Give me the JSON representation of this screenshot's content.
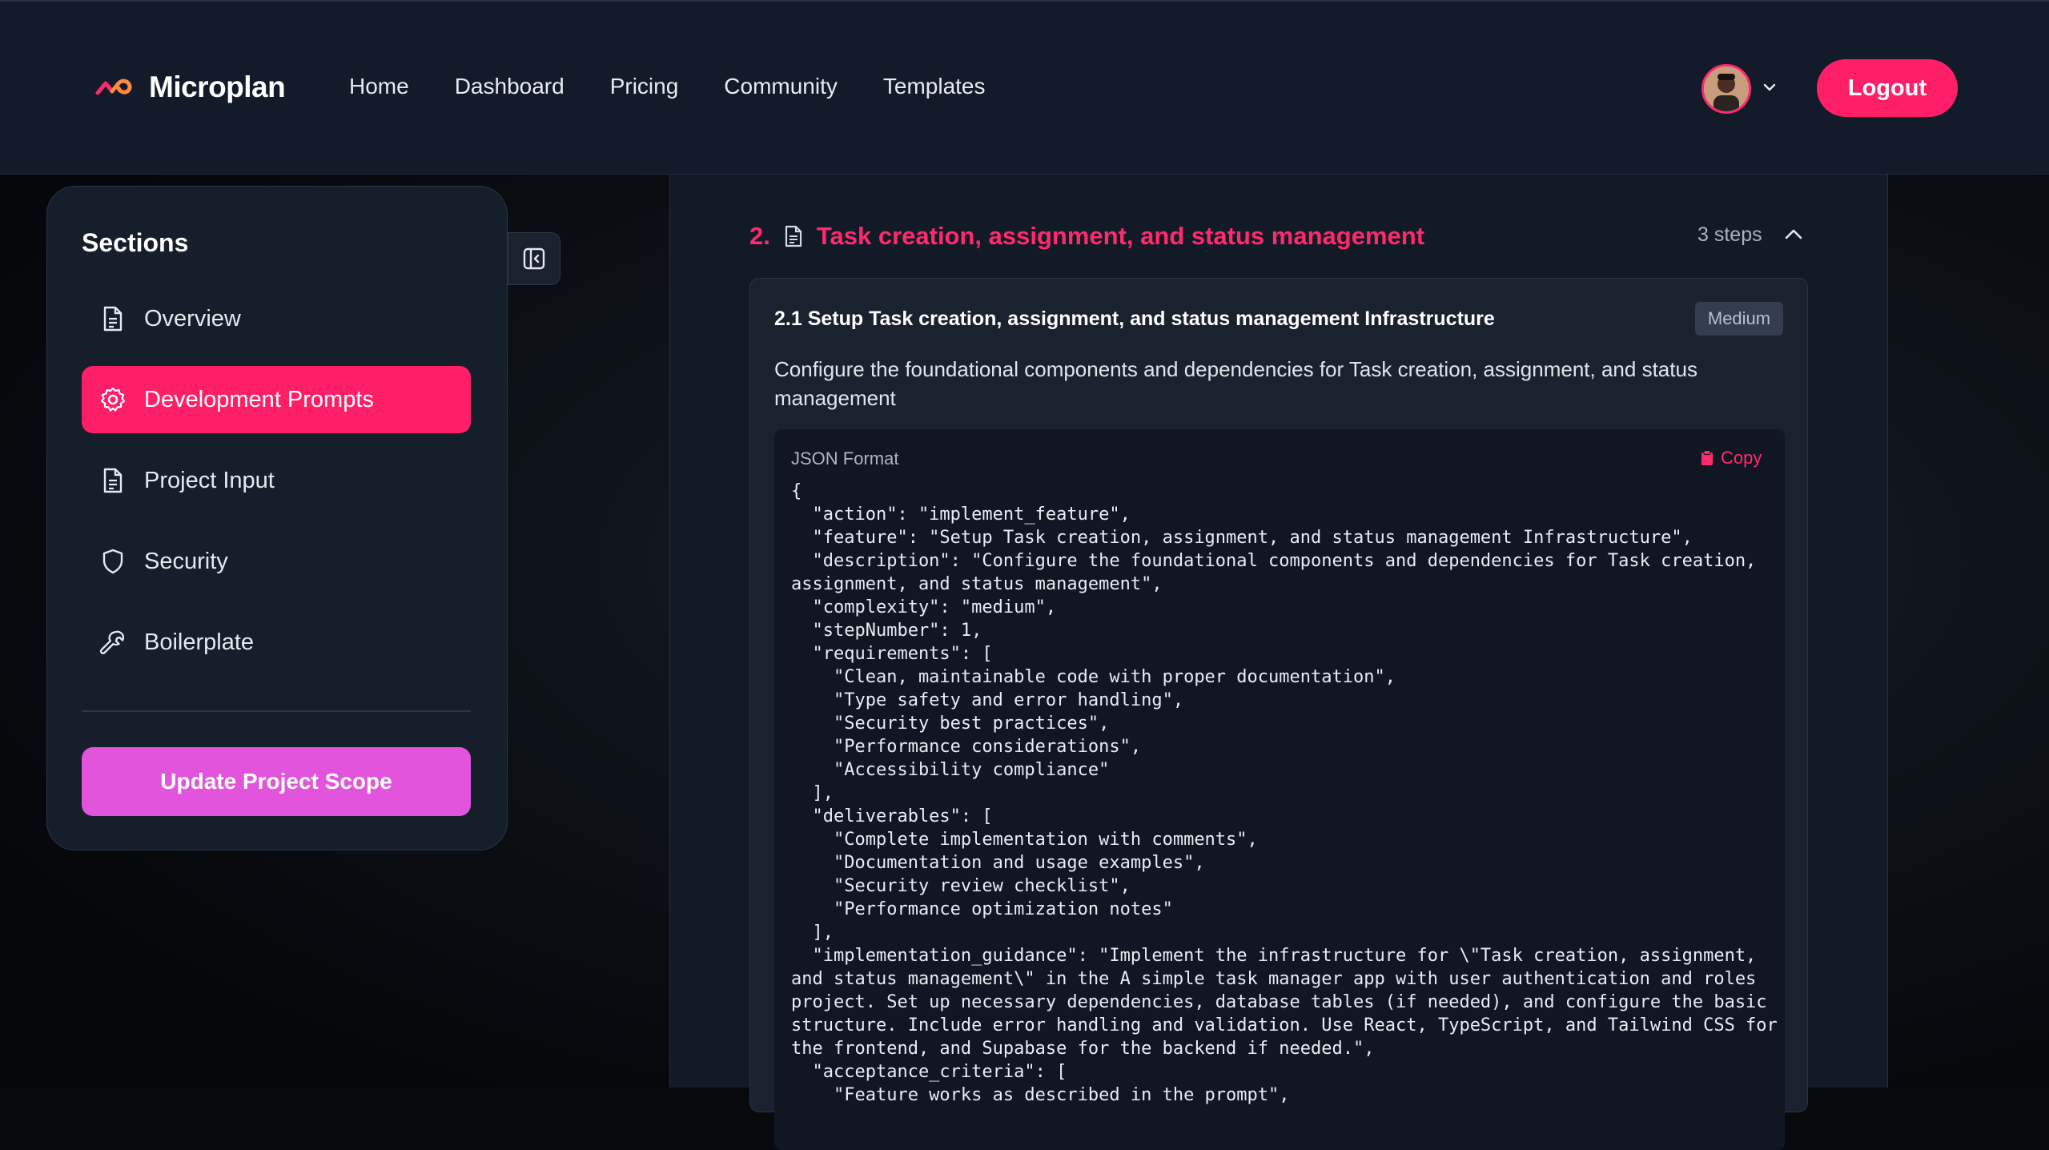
{
  "header": {
    "brand": "Microplan",
    "nav": [
      "Home",
      "Dashboard",
      "Pricing",
      "Community",
      "Templates"
    ],
    "logout_label": "Logout"
  },
  "sidebar": {
    "title": "Sections",
    "items": [
      {
        "label": "Overview",
        "icon": "document-icon",
        "active": false
      },
      {
        "label": "Development Prompts",
        "icon": "gear-icon",
        "active": true
      },
      {
        "label": "Project Input",
        "icon": "document-icon",
        "active": false
      },
      {
        "label": "Security",
        "icon": "shield-icon",
        "active": false
      },
      {
        "label": "Boilerplate",
        "icon": "wrench-icon",
        "active": false
      }
    ],
    "update_label": "Update Project Scope"
  },
  "section": {
    "number": "2.",
    "title": "Task creation, assignment, and status management",
    "steps": "3 steps"
  },
  "step": {
    "title": "2.1 Setup Task creation, assignment, and status management Infrastructure",
    "badge": "Medium",
    "description": "Configure the foundational components and dependencies for Task creation, assignment, and status management",
    "code_label": "JSON Format",
    "copy_label": "Copy",
    "code": "{\n  \"action\": \"implement_feature\",\n  \"feature\": \"Setup Task creation, assignment, and status management Infrastructure\",\n  \"description\": \"Configure the foundational components and dependencies for Task creation,\nassignment, and status management\",\n  \"complexity\": \"medium\",\n  \"stepNumber\": 1,\n  \"requirements\": [\n    \"Clean, maintainable code with proper documentation\",\n    \"Type safety and error handling\",\n    \"Security best practices\",\n    \"Performance considerations\",\n    \"Accessibility compliance\"\n  ],\n  \"deliverables\": [\n    \"Complete implementation with comments\",\n    \"Documentation and usage examples\",\n    \"Security review checklist\",\n    \"Performance optimization notes\"\n  ],\n  \"implementation_guidance\": \"Implement the infrastructure for \\\"Task creation, assignment,\nand status management\\\" in the A simple task manager app with user authentication and roles\nproject. Set up necessary dependencies, database tables (if needed), and configure the basic\nstructure. Include error handling and validation. Use React, TypeScript, and Tailwind CSS for\nthe frontend, and Supabase for the backend if needed.\",\n  \"acceptance_criteria\": [\n    \"Feature works as described in the prompt\","
  },
  "colors": {
    "accent": "#ff1f69",
    "update_button": "#e254dc",
    "header_bg": "#131b2a"
  }
}
